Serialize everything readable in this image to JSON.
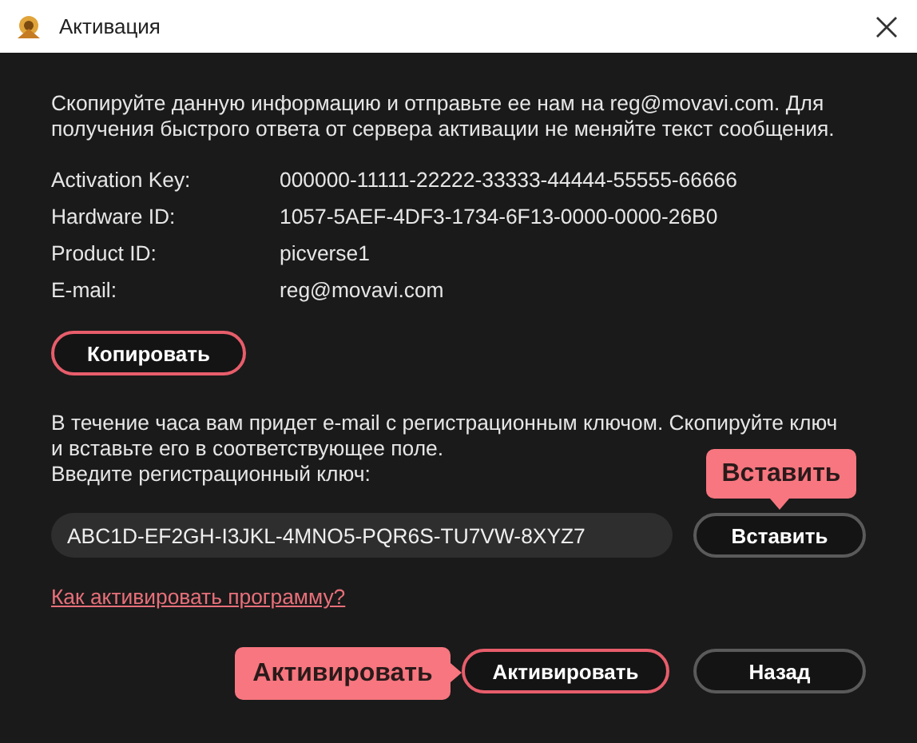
{
  "window": {
    "title": "Активация"
  },
  "intro": "Скопируйте данную информацию и отправьте ее нам на reg@movavi.com. Для получения быстрого ответа от сервера активации не меняйте текст сообщения.",
  "info": [
    {
      "label": "Activation Key:",
      "value": "000000-11111-22222-33333-44444-55555-66666"
    },
    {
      "label": "Hardware ID:",
      "value": "1057-5AEF-4DF3-1734-6F13-0000-0000-26B0"
    },
    {
      "label": "Product ID:",
      "value": "picverse1"
    },
    {
      "label": "E-mail:",
      "value": "reg@movavi.com"
    }
  ],
  "copy_button": {
    "label": "Копировать",
    "highlighted": true
  },
  "instructions": "В течение часа вам придет e-mail с регистрационным ключом. Скопируйте ключ и вставьте его в соответствующее поле.",
  "key_prompt": "Введите регистрационный ключ:",
  "key_field": {
    "value": "ABC1D-EF2GH-I3JKL-4MNO5-PQR6S-TU7VW-8XYZ7"
  },
  "paste_button": {
    "label": "Вставить",
    "highlighted": false,
    "callout": "Вставить"
  },
  "help_link": "Как активировать программу?",
  "activate_button": {
    "label": "Активировать",
    "highlighted": true,
    "callout": "Активировать"
  },
  "back_button": {
    "label": "Назад",
    "highlighted": false
  }
}
